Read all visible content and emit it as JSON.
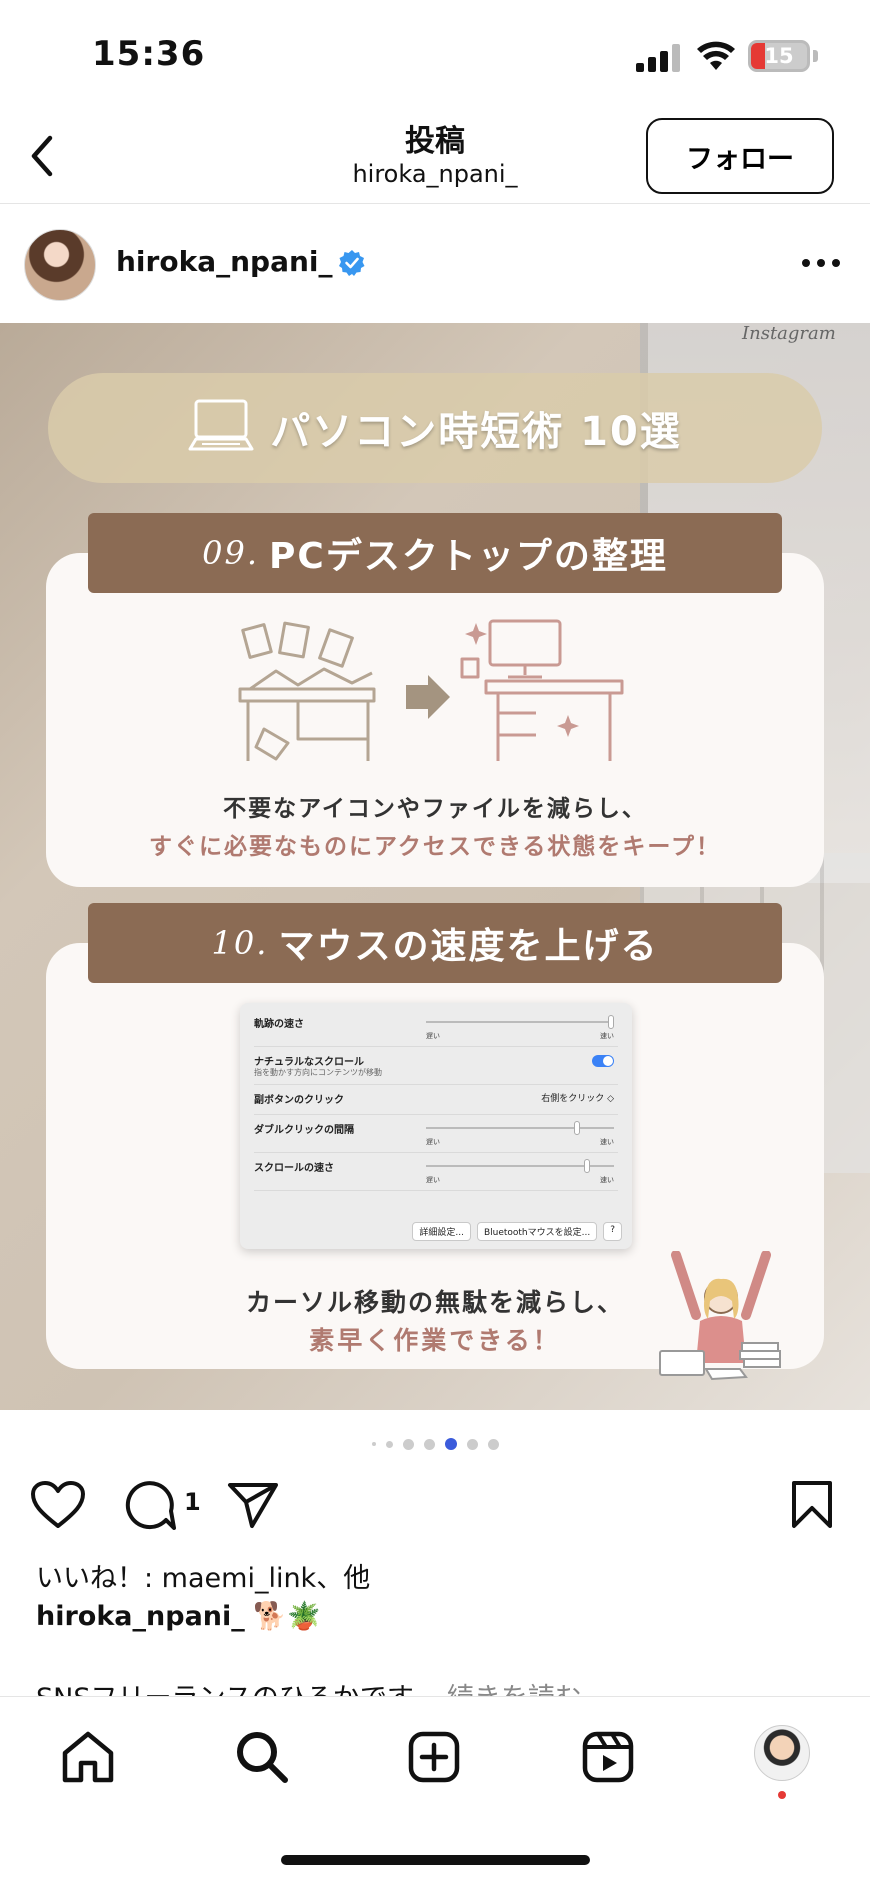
{
  "status": {
    "time": "15:36",
    "battery": "15",
    "battery_color": "#e53935"
  },
  "topbar": {
    "title": "投稿",
    "subtitle": "hiroka_npani_",
    "follow_label": "フォロー",
    "back_icon": "chevron-left-icon"
  },
  "post": {
    "username": "hiroka_npani_",
    "verified_color": "#3897f0"
  },
  "slide": {
    "watermark": "Instagram",
    "banner_title": "パソコン時短術 10選",
    "section1": {
      "number": "09.",
      "title": "PCデスクトップの整理",
      "caption_line1": "不要なアイコンやファイルを減らし、",
      "caption_line2": "すぐに必要なものにアクセスできる状態をキープ！"
    },
    "section2": {
      "number": "10.",
      "title": "マウスの速度を上げる",
      "caption_line1": "カーソル移動の無駄を減らし、",
      "caption_line2": "素早く作業できる！"
    },
    "settings": {
      "tracking_speed": "軌跡の速さ",
      "natural_scroll": "ナチュラルなスクロール",
      "natural_scroll_sub": "指を動かす方向にコンテンツが移動",
      "secondary_click": "副ボタンのクリック",
      "secondary_click_value": "右側をクリック ◇",
      "double_click": "ダブルクリックの間隔",
      "scroll_speed": "スクロールの速さ",
      "slow": "遅い",
      "fast": "速い",
      "advanced_btn": "詳細設定...",
      "bluetooth_btn": "Bluetoothマウスを設定...",
      "help_btn": "?"
    },
    "accent_colors": {
      "brown_bar": "#8b6b54",
      "pink_text": "#b07a70",
      "banner": "#d9cbaa"
    }
  },
  "carousel": {
    "active_index": 4,
    "count": 7,
    "active_color": "#3b5bdb"
  },
  "actions": {
    "comment_count": "1"
  },
  "likes_text": "いいね！: maemi_link、他",
  "caption": {
    "user": "hiroka_npani_",
    "emoji": "🐕🪴",
    "preview": "SNSフリーランスのひろかです。",
    "more": "続きを読む"
  }
}
